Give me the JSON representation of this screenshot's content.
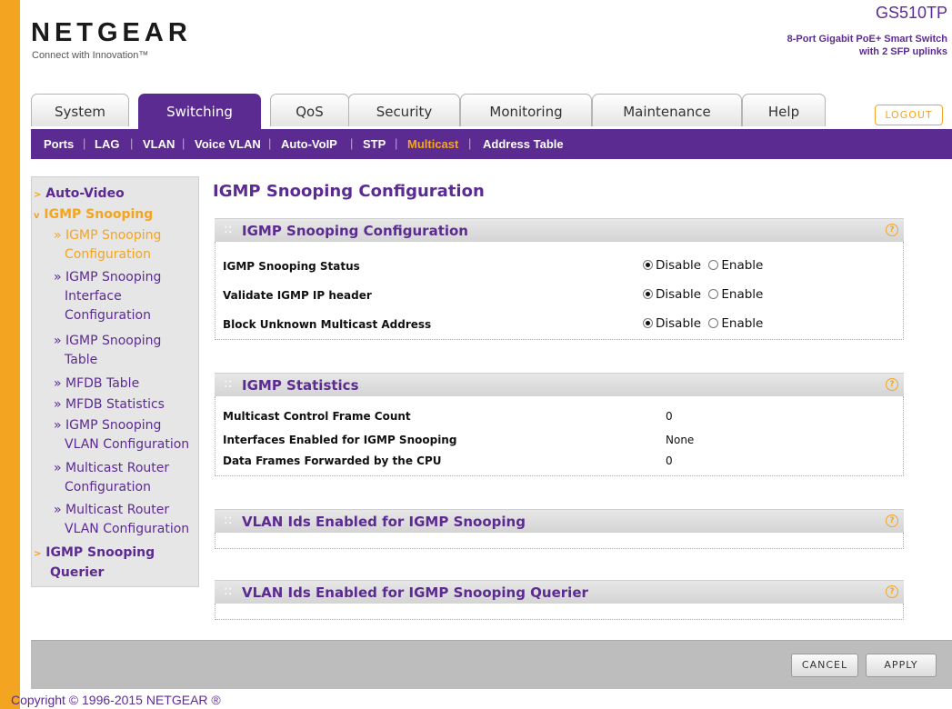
{
  "header": {
    "brand": "NETGEAR",
    "tagline": "Connect with Innovation™",
    "model": "GS510TP",
    "model_desc_line1": "8-Port Gigabit PoE+ Smart Switch",
    "model_desc_line2": "with 2 SFP uplinks",
    "logout": "LOGOUT"
  },
  "tabs": [
    "System",
    "Switching",
    "QoS",
    "Security",
    "Monitoring",
    "Maintenance",
    "Help"
  ],
  "subnav": [
    "Ports",
    "LAG",
    "VLAN",
    "Voice VLAN",
    "Auto-VoIP",
    "STP",
    "Multicast",
    "Address Table"
  ],
  "sidebar": {
    "auto_video": "Auto-Video",
    "igmp_snooping": "IGMP Snooping",
    "items": [
      [
        "» IGMP Snooping",
        "Configuration"
      ],
      [
        "» IGMP Snooping",
        "Interface",
        "Configuration"
      ],
      [
        "» IGMP Snooping",
        "Table"
      ],
      [
        "» MFDB Table"
      ],
      [
        "» MFDB Statistics"
      ],
      [
        "» IGMP Snooping",
        "VLAN Configuration"
      ],
      [
        "» Multicast Router",
        "Configuration"
      ],
      [
        "» Multicast Router",
        "VLAN Configuration"
      ]
    ],
    "querier": [
      "IGMP Snooping",
      "Querier"
    ]
  },
  "main": {
    "page_title": "IGMP Snooping Configuration",
    "panel1": {
      "title": "IGMP Snooping Configuration",
      "rows": [
        {
          "label": "IGMP Snooping Status",
          "selected": "Disable"
        },
        {
          "label": "Validate IGMP IP header",
          "selected": "Disable"
        },
        {
          "label": "Block Unknown Multicast Address",
          "selected": "Disable"
        }
      ],
      "opt_disable": "Disable",
      "opt_enable": "Enable"
    },
    "panel2": {
      "title": "IGMP Statistics",
      "rows": [
        {
          "label": "Multicast Control Frame Count",
          "value": "0"
        },
        {
          "label": "Interfaces Enabled for IGMP Snooping",
          "value": "None"
        },
        {
          "label": "Data Frames Forwarded by the CPU",
          "value": "0"
        }
      ]
    },
    "panel3": {
      "title": "VLAN Ids Enabled for IGMP Snooping"
    },
    "panel4": {
      "title": "VLAN Ids Enabled for IGMP Snooping Querier"
    },
    "help": "?",
    "dots": "::"
  },
  "buttons": {
    "cancel": "CANCEL",
    "apply": "APPLY"
  },
  "copyright": "Copyright © 1996-2015 NETGEAR ®",
  "colors": {
    "purple": "#5c2b91",
    "orange": "#f3a521",
    "grey": "#bdbdbd"
  }
}
